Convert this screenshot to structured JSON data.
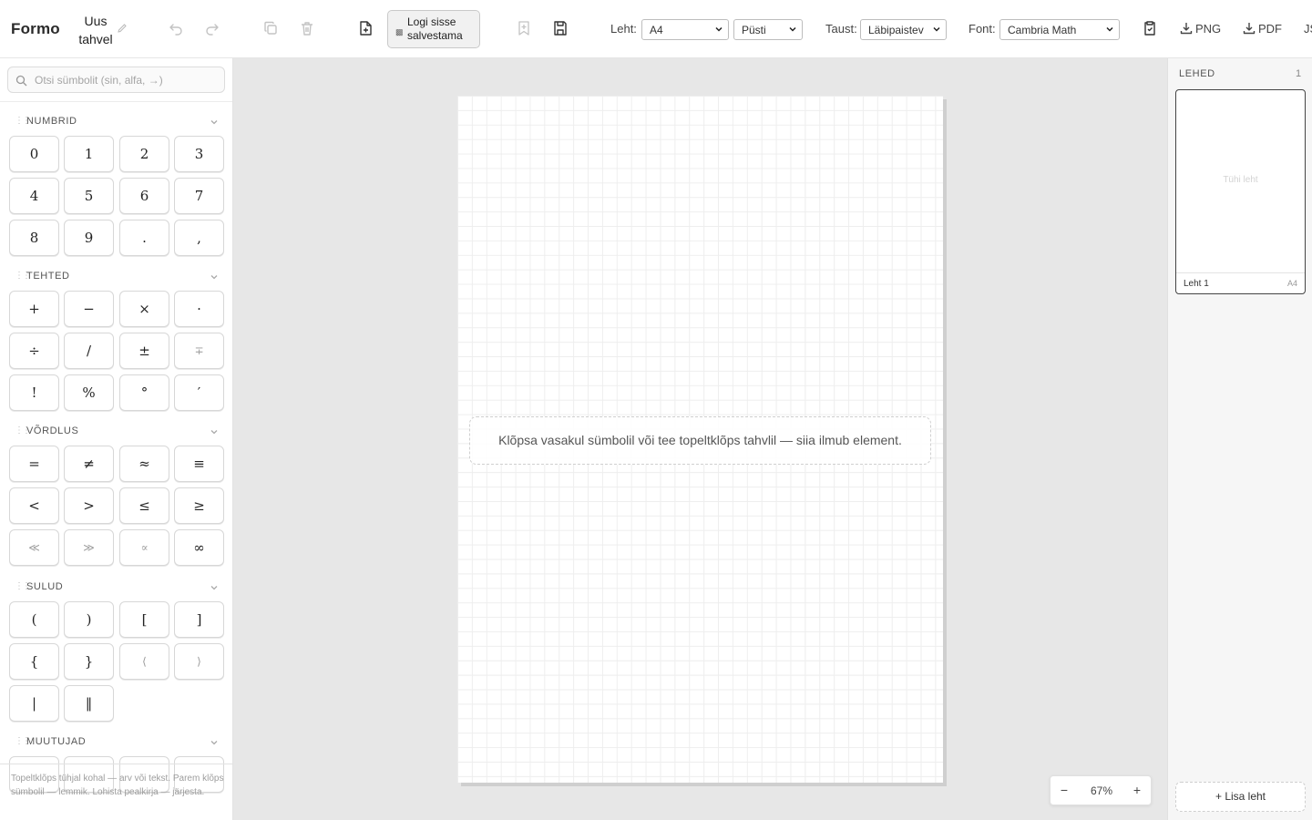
{
  "app": {
    "brand": "Formo",
    "doc_title": "Uus tahvel"
  },
  "toolbar": {
    "login_label": "Logi sisse salvestama",
    "sheet_label": "Leht:",
    "sheet_size": "A4",
    "orientation": "Püsti",
    "background_label": "Taust:",
    "background": "Läbipaistev",
    "font_label": "Font:",
    "font": "Cambria Math",
    "png_label": "PNG",
    "pdf_label": "PDF",
    "overflow_label": "JS"
  },
  "left": {
    "search_placeholder": "Otsi sümbolit (sin, alfa, →)",
    "sections": [
      {
        "title": "NUMBRID",
        "keys": [
          "0",
          "1",
          "2",
          "3",
          "4",
          "5",
          "6",
          "7",
          "8",
          "9",
          ".",
          ","
        ]
      },
      {
        "title": "TEHTED",
        "keys": [
          "+",
          "−",
          "×",
          "·",
          "÷",
          "/",
          "±",
          "∓",
          "!",
          "%",
          "°",
          "′"
        ]
      },
      {
        "title": "VÕRDLUS",
        "keys": [
          "=",
          "≠",
          "≈",
          "≡",
          "<",
          ">",
          "≤",
          "≥",
          "≪",
          "≫",
          "∝",
          "∞"
        ]
      },
      {
        "title": "SULUD",
        "keys": [
          "(",
          ")",
          "[",
          "]",
          "{",
          "}",
          "⟨",
          "⟩",
          "|",
          "‖"
        ]
      },
      {
        "title": "MUUTUJAD",
        "keys": []
      }
    ],
    "hint": "Topeltklõps tühjal kohal — arv või tekst. Parem klõps sümbolil — lemmik. Lohista pealkirja — järjesta."
  },
  "canvas": {
    "empty_hint": "Klõpsa vasakul sümbolil või tee topeltklõps tahvlil — siia ilmub element.",
    "zoom": "67%",
    "zoom_out": "−",
    "zoom_in": "+"
  },
  "pages": {
    "title": "LEHED",
    "count": "1",
    "items": [
      {
        "name": "Leht 1",
        "size": "A4",
        "empty_label": "Tühi leht"
      }
    ],
    "add_label": "Lisa leht"
  }
}
